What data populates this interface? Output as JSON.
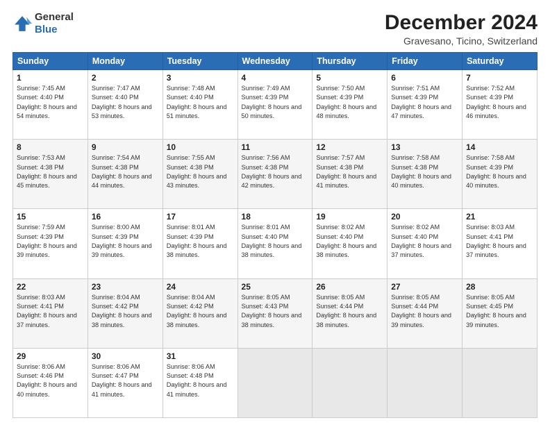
{
  "header": {
    "logo_general": "General",
    "logo_blue": "Blue",
    "month_title": "December 2024",
    "location": "Gravesano, Ticino, Switzerland"
  },
  "weekdays": [
    "Sunday",
    "Monday",
    "Tuesday",
    "Wednesday",
    "Thursday",
    "Friday",
    "Saturday"
  ],
  "weeks": [
    [
      {
        "day": "1",
        "sunrise": "Sunrise: 7:45 AM",
        "sunset": "Sunset: 4:40 PM",
        "daylight": "Daylight: 8 hours and 54 minutes."
      },
      {
        "day": "2",
        "sunrise": "Sunrise: 7:47 AM",
        "sunset": "Sunset: 4:40 PM",
        "daylight": "Daylight: 8 hours and 53 minutes."
      },
      {
        "day": "3",
        "sunrise": "Sunrise: 7:48 AM",
        "sunset": "Sunset: 4:40 PM",
        "daylight": "Daylight: 8 hours and 51 minutes."
      },
      {
        "day": "4",
        "sunrise": "Sunrise: 7:49 AM",
        "sunset": "Sunset: 4:39 PM",
        "daylight": "Daylight: 8 hours and 50 minutes."
      },
      {
        "day": "5",
        "sunrise": "Sunrise: 7:50 AM",
        "sunset": "Sunset: 4:39 PM",
        "daylight": "Daylight: 8 hours and 48 minutes."
      },
      {
        "day": "6",
        "sunrise": "Sunrise: 7:51 AM",
        "sunset": "Sunset: 4:39 PM",
        "daylight": "Daylight: 8 hours and 47 minutes."
      },
      {
        "day": "7",
        "sunrise": "Sunrise: 7:52 AM",
        "sunset": "Sunset: 4:39 PM",
        "daylight": "Daylight: 8 hours and 46 minutes."
      }
    ],
    [
      {
        "day": "8",
        "sunrise": "Sunrise: 7:53 AM",
        "sunset": "Sunset: 4:38 PM",
        "daylight": "Daylight: 8 hours and 45 minutes."
      },
      {
        "day": "9",
        "sunrise": "Sunrise: 7:54 AM",
        "sunset": "Sunset: 4:38 PM",
        "daylight": "Daylight: 8 hours and 44 minutes."
      },
      {
        "day": "10",
        "sunrise": "Sunrise: 7:55 AM",
        "sunset": "Sunset: 4:38 PM",
        "daylight": "Daylight: 8 hours and 43 minutes."
      },
      {
        "day": "11",
        "sunrise": "Sunrise: 7:56 AM",
        "sunset": "Sunset: 4:38 PM",
        "daylight": "Daylight: 8 hours and 42 minutes."
      },
      {
        "day": "12",
        "sunrise": "Sunrise: 7:57 AM",
        "sunset": "Sunset: 4:38 PM",
        "daylight": "Daylight: 8 hours and 41 minutes."
      },
      {
        "day": "13",
        "sunrise": "Sunrise: 7:58 AM",
        "sunset": "Sunset: 4:38 PM",
        "daylight": "Daylight: 8 hours and 40 minutes."
      },
      {
        "day": "14",
        "sunrise": "Sunrise: 7:58 AM",
        "sunset": "Sunset: 4:39 PM",
        "daylight": "Daylight: 8 hours and 40 minutes."
      }
    ],
    [
      {
        "day": "15",
        "sunrise": "Sunrise: 7:59 AM",
        "sunset": "Sunset: 4:39 PM",
        "daylight": "Daylight: 8 hours and 39 minutes."
      },
      {
        "day": "16",
        "sunrise": "Sunrise: 8:00 AM",
        "sunset": "Sunset: 4:39 PM",
        "daylight": "Daylight: 8 hours and 39 minutes."
      },
      {
        "day": "17",
        "sunrise": "Sunrise: 8:01 AM",
        "sunset": "Sunset: 4:39 PM",
        "daylight": "Daylight: 8 hours and 38 minutes."
      },
      {
        "day": "18",
        "sunrise": "Sunrise: 8:01 AM",
        "sunset": "Sunset: 4:40 PM",
        "daylight": "Daylight: 8 hours and 38 minutes."
      },
      {
        "day": "19",
        "sunrise": "Sunrise: 8:02 AM",
        "sunset": "Sunset: 4:40 PM",
        "daylight": "Daylight: 8 hours and 38 minutes."
      },
      {
        "day": "20",
        "sunrise": "Sunrise: 8:02 AM",
        "sunset": "Sunset: 4:40 PM",
        "daylight": "Daylight: 8 hours and 37 minutes."
      },
      {
        "day": "21",
        "sunrise": "Sunrise: 8:03 AM",
        "sunset": "Sunset: 4:41 PM",
        "daylight": "Daylight: 8 hours and 37 minutes."
      }
    ],
    [
      {
        "day": "22",
        "sunrise": "Sunrise: 8:03 AM",
        "sunset": "Sunset: 4:41 PM",
        "daylight": "Daylight: 8 hours and 37 minutes."
      },
      {
        "day": "23",
        "sunrise": "Sunrise: 8:04 AM",
        "sunset": "Sunset: 4:42 PM",
        "daylight": "Daylight: 8 hours and 38 minutes."
      },
      {
        "day": "24",
        "sunrise": "Sunrise: 8:04 AM",
        "sunset": "Sunset: 4:42 PM",
        "daylight": "Daylight: 8 hours and 38 minutes."
      },
      {
        "day": "25",
        "sunrise": "Sunrise: 8:05 AM",
        "sunset": "Sunset: 4:43 PM",
        "daylight": "Daylight: 8 hours and 38 minutes."
      },
      {
        "day": "26",
        "sunrise": "Sunrise: 8:05 AM",
        "sunset": "Sunset: 4:44 PM",
        "daylight": "Daylight: 8 hours and 38 minutes."
      },
      {
        "day": "27",
        "sunrise": "Sunrise: 8:05 AM",
        "sunset": "Sunset: 4:44 PM",
        "daylight": "Daylight: 8 hours and 39 minutes."
      },
      {
        "day": "28",
        "sunrise": "Sunrise: 8:05 AM",
        "sunset": "Sunset: 4:45 PM",
        "daylight": "Daylight: 8 hours and 39 minutes."
      }
    ],
    [
      {
        "day": "29",
        "sunrise": "Sunrise: 8:06 AM",
        "sunset": "Sunset: 4:46 PM",
        "daylight": "Daylight: 8 hours and 40 minutes."
      },
      {
        "day": "30",
        "sunrise": "Sunrise: 8:06 AM",
        "sunset": "Sunset: 4:47 PM",
        "daylight": "Daylight: 8 hours and 41 minutes."
      },
      {
        "day": "31",
        "sunrise": "Sunrise: 8:06 AM",
        "sunset": "Sunset: 4:48 PM",
        "daylight": "Daylight: 8 hours and 41 minutes."
      },
      null,
      null,
      null,
      null
    ]
  ]
}
